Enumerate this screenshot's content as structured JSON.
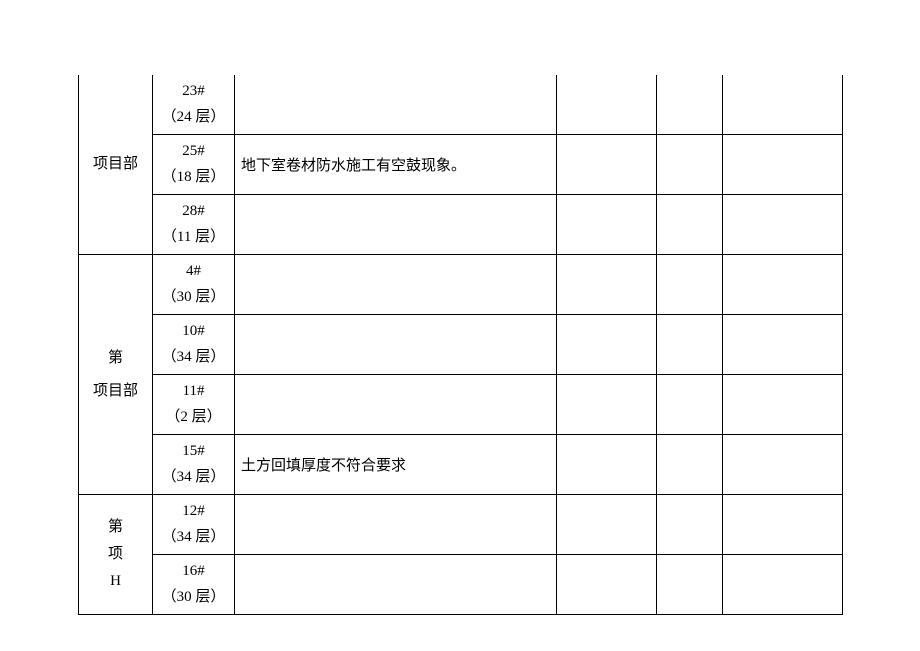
{
  "groups": [
    {
      "label_lines": [
        "项目部"
      ],
      "rows": [
        {
          "code": "23#",
          "floor": "（24 层）",
          "desc": ""
        },
        {
          "code": "25#",
          "floor": "（18 层）",
          "desc": "地下室卷材防水施工有空鼓现象。"
        },
        {
          "code": "28#",
          "floor": "（11 层）",
          "desc": ""
        }
      ]
    },
    {
      "label_lines": [
        "第",
        "项目部"
      ],
      "rows": [
        {
          "code": "4#",
          "floor": "（30 层）",
          "desc": ""
        },
        {
          "code": "10#",
          "floor": "（34 层）",
          "desc": ""
        },
        {
          "code": "11#",
          "floor": "（2 层）",
          "desc": ""
        },
        {
          "code": "15#",
          "floor": "（34 层）",
          "desc": "土方回填厚度不符合要求"
        }
      ]
    },
    {
      "label_lines": [
        "第",
        "项",
        "H"
      ],
      "rows": [
        {
          "code": "12#",
          "floor": "（34 层）",
          "desc": ""
        },
        {
          "code": "16#",
          "floor": "（30 层）",
          "desc": ""
        }
      ]
    }
  ]
}
